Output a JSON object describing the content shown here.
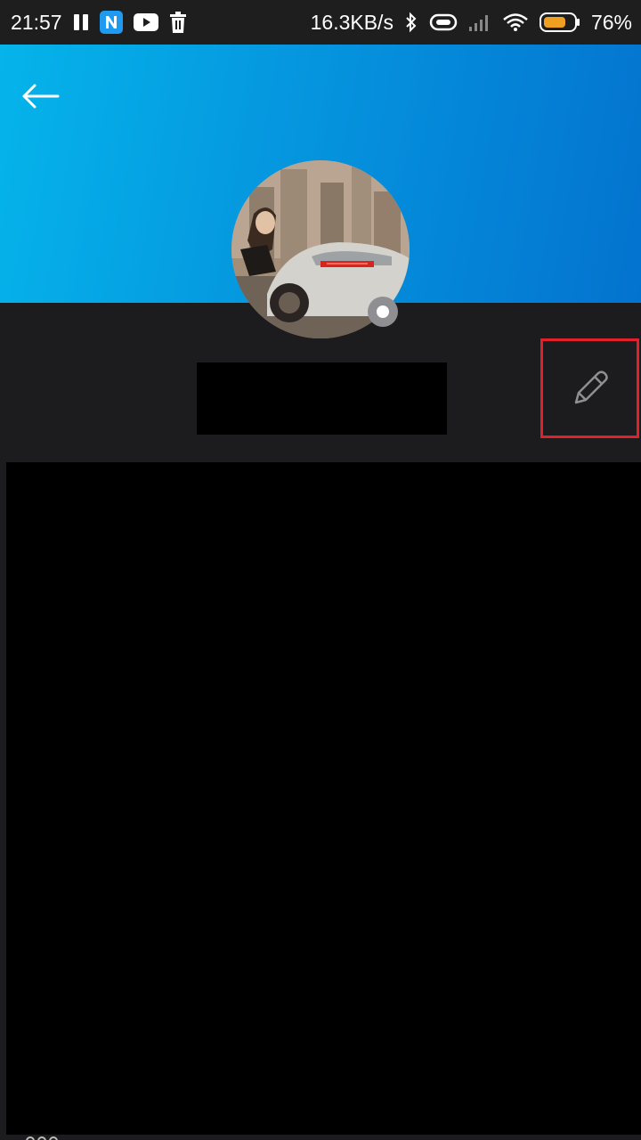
{
  "status_bar": {
    "time": "21:57",
    "left_icons": [
      "pause-icon",
      "app-n-icon",
      "youtube-icon",
      "trash-icon"
    ],
    "net_speed": "16.3KB/s",
    "right_icons": [
      "bluetooth-icon",
      "vibrate-icon",
      "signal-icon",
      "wifi-icon",
      "battery-icon"
    ],
    "battery_percent": "76%",
    "battery_level": 0.76,
    "battery_color": "#f0a020"
  },
  "header": {
    "gradient_start": "#05b4ea",
    "gradient_end": "#0373cf",
    "back_icon": "arrow-left-icon"
  },
  "profile": {
    "avatar": "avatar-image",
    "status_indicator": "offline",
    "name": "",
    "edit_icon": "pencil-icon",
    "highlight_color": "#e0202a"
  }
}
